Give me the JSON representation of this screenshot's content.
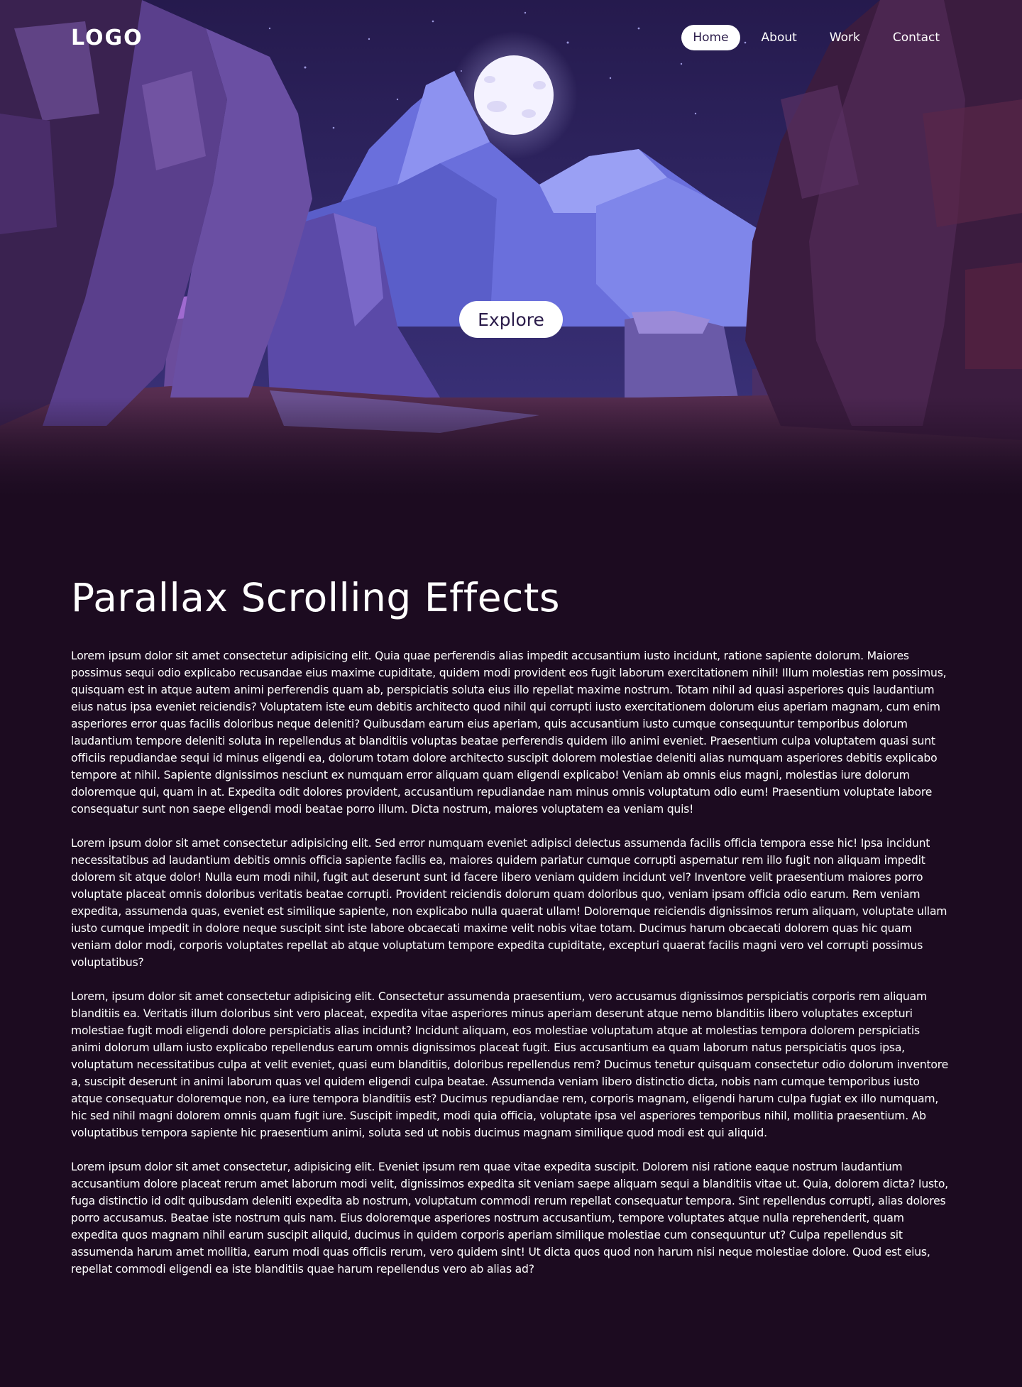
{
  "header": {
    "logo": "LOGO",
    "nav": [
      {
        "label": "Home",
        "active": true
      },
      {
        "label": "About",
        "active": false
      },
      {
        "label": "Work",
        "active": false
      },
      {
        "label": "Contact",
        "active": false
      }
    ]
  },
  "hero": {
    "explore_label": "Explore",
    "colors": {
      "sky": "#2b1d57",
      "mountain_light": "#7a80e6",
      "mountain_mid": "#5b5fc8",
      "rock_purple": "#5a3c8c",
      "rock_dark": "#3a1f4a",
      "moon": "#f4f2ff"
    }
  },
  "main": {
    "title": "Parallax Scrolling Effects",
    "paragraphs": [
      "Lorem ipsum dolor sit amet consectetur adipisicing elit. Quia quae perferendis alias impedit accusantium iusto incidunt, ratione sapiente dolorum. Maiores possimus sequi odio explicabo recusandae eius maxime cupiditate, quidem modi provident eos fugit laborum exercitationem nihil! Illum molestias rem possimus, quisquam est in atque autem animi perferendis quam ab, perspiciatis soluta eius illo repellat maxime nostrum. Totam nihil ad quasi asperiores quis laudantium eius natus ipsa eveniet reiciendis? Voluptatem iste eum debitis architecto quod nihil qui corrupti iusto exercitationem dolorum eius aperiam magnam, cum enim asperiores error quas facilis doloribus neque deleniti? Quibusdam earum eius aperiam, quis accusantium iusto cumque consequuntur temporibus dolorum laudantium tempore deleniti soluta in repellendus at blanditiis voluptas beatae perferendis quidem illo animi eveniet. Praesentium culpa voluptatem quasi sunt officiis repudiandae sequi id minus eligendi ea, dolorum totam dolore architecto suscipit dolorem molestiae deleniti alias numquam asperiores debitis explicabo tempore at nihil. Sapiente dignissimos nesciunt ex numquam error aliquam quam eligendi explicabo! Veniam ab omnis eius magni, molestias iure dolorum doloremque qui, quam in at. Expedita odit dolores provident, accusantium repudiandae nam minus omnis voluptatum odio eum! Praesentium voluptate labore consequatur sunt non saepe eligendi modi beatae porro illum. Dicta nostrum, maiores voluptatem ea veniam quis!",
      "Lorem ipsum dolor sit amet consectetur adipisicing elit. Sed error numquam eveniet adipisci delectus assumenda facilis officia tempora esse hic! Ipsa incidunt necessitatibus ad laudantium debitis omnis officia sapiente facilis ea, maiores quidem pariatur cumque corrupti aspernatur rem illo fugit non aliquam impedit dolorem sit atque dolor! Nulla eum modi nihil, fugit aut deserunt sunt id facere libero veniam quidem incidunt vel? Inventore velit praesentium maiores porro voluptate placeat omnis doloribus veritatis beatae corrupti. Provident reiciendis dolorum quam doloribus quo, veniam ipsam officia odio earum. Rem veniam expedita, assumenda quas, eveniet est similique sapiente, non explicabo nulla quaerat ullam! Doloremque reiciendis dignissimos rerum aliquam, voluptate ullam iusto cumque impedit in dolore neque suscipit sint iste labore obcaecati maxime velit nobis vitae totam. Ducimus harum obcaecati dolorem quas hic quam veniam dolor modi, corporis voluptates repellat ab atque voluptatum tempore expedita cupiditate, excepturi quaerat facilis magni vero vel corrupti possimus voluptatibus?",
      "Lorem, ipsum dolor sit amet consectetur adipisicing elit. Consectetur assumenda praesentium, vero accusamus dignissimos perspiciatis corporis rem aliquam blanditiis ea. Veritatis illum doloribus sint vero placeat, expedita vitae asperiores minus aperiam deserunt atque nemo blanditiis libero voluptates excepturi molestiae fugit modi eligendi dolore perspiciatis alias incidunt? Incidunt aliquam, eos molestiae voluptatum atque at molestias tempora dolorem perspiciatis animi dolorum ullam iusto explicabo repellendus earum omnis dignissimos placeat fugit. Eius accusantium ea quam laborum natus perspiciatis quos ipsa, voluptatum necessitatibus culpa at velit eveniet, quasi eum blanditiis, doloribus repellendus rem? Ducimus tenetur quisquam consectetur odio dolorum inventore a, suscipit deserunt in animi laborum quas vel quidem eligendi culpa beatae. Assumenda veniam libero distinctio dicta, nobis nam cumque temporibus iusto atque consequatur doloremque non, ea iure tempora blanditiis est? Ducimus repudiandae rem, corporis magnam, eligendi harum culpa fugiat ex illo numquam, hic sed nihil magni dolorem omnis quam fugit iure. Suscipit impedit, modi quia officia, voluptate ipsa vel asperiores temporibus nihil, mollitia praesentium. Ab voluptatibus tempora sapiente hic praesentium animi, soluta sed ut nobis ducimus magnam similique quod modi est qui aliquid.",
      "Lorem ipsum dolor sit amet consectetur, adipisicing elit. Eveniet ipsum rem quae vitae expedita suscipit. Dolorem nisi ratione eaque nostrum laudantium accusantium dolore placeat rerum amet laborum modi velit, dignissimos expedita sit veniam saepe aliquam sequi a blanditiis vitae ut. Quia, dolorem dicta? Iusto, fuga distinctio id odit quibusdam deleniti expedita ab nostrum, voluptatum commodi rerum repellat consequatur tempora. Sint repellendus corrupti, alias dolores porro accusamus. Beatae iste nostrum quis nam. Eius doloremque asperiores nostrum accusantium, tempore voluptates atque nulla reprehenderit, quam expedita quos magnam nihil earum suscipit aliquid, ducimus in quidem corporis aperiam similique molestiae cum consequuntur ut? Culpa repellendus sit assumenda harum amet mollitia, earum modi quas officiis rerum, vero quidem sint! Ut dicta quos quod non harum nisi neque molestiae dolore. Quod est eius, repellat commodi eligendi ea iste blanditiis quae harum repellendus vero ab alias ad?"
    ]
  }
}
